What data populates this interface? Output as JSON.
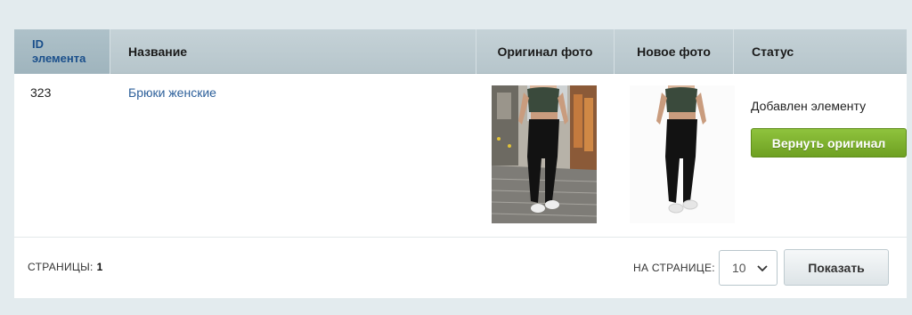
{
  "table": {
    "columns": {
      "id_line1": "ID",
      "id_line2": "элемента",
      "name": "Название",
      "original_photo": "Оригинал фото",
      "new_photo": "Новое фото",
      "status": "Статус"
    },
    "rows": [
      {
        "id": "323",
        "name": "Брюки женские",
        "original_photo_icon": "photo-woman-black-pants-street",
        "new_photo_icon": "photo-woman-black-pants-white-bg",
        "status_text": "Добавлен элементу",
        "restore_button": "Вернуть оригинал"
      }
    ]
  },
  "footer": {
    "pages_label": "СТРАНИЦЫ:",
    "pages_value": "1",
    "per_page_label": "НА СТРАНИЦЕ:",
    "per_page_value": "10",
    "show_button": "Показать"
  },
  "colors": {
    "background": "#e3ebee",
    "header": "#b6c5cb",
    "link": "#2c5f9a",
    "button_green": "#7ab02c"
  }
}
